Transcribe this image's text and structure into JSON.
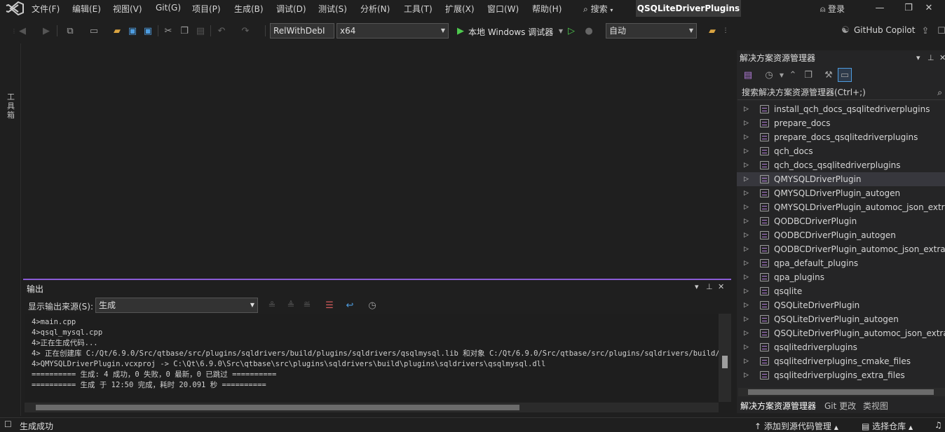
{
  "menu": [
    "文件(F)",
    "编辑(E)",
    "视图(V)",
    "Git(G)",
    "项目(P)",
    "生成(B)",
    "调试(D)",
    "测试(S)",
    "分析(N)",
    "工具(T)",
    "扩展(X)",
    "窗口(W)",
    "帮助(H)"
  ],
  "search_label": "搜索",
  "solution_name": "QSQLiteDriverPlugins",
  "login_label": "登录",
  "toolbar": {
    "config": "RelWithDebI",
    "platform": "x64",
    "run_label": "本地 Windows 调试器",
    "auto_label": "自动",
    "copilot_label": "GitHub Copilot"
  },
  "toolbox_label": "工具箱",
  "output": {
    "title": "输出",
    "source_label": "显示输出来源(S):",
    "source_value": "生成",
    "lines": [
      "4>main.cpp",
      "4>qsql_mysql.cpp",
      "4>正在生成代码...",
      "4>  正在创建库 C:/Qt/6.9.0/Src/qtbase/src/plugins/sqldrivers/build/plugins/sqldrivers/qsqlmysql.lib 和对象 C:/Qt/6.9.0/Src/qtbase/src/plugins/sqldrivers/build/plug",
      "4>QMYSQLDriverPlugin.vcxproj -> C:\\Qt\\6.9.0\\Src\\qtbase\\src\\plugins\\sqldrivers\\build\\plugins\\sqldrivers\\qsqlmysql.dll",
      "========== 生成: 4 成功，0 失败，0 最新，0 已跳过 ==========",
      "========== 生成 于 12:50 完成，耗时 20.091 秒 =========="
    ]
  },
  "solution_explorer": {
    "title": "解决方案资源管理器",
    "search_placeholder": "搜索解决方案资源管理器(Ctrl+;)",
    "items": [
      "install_qch_docs_qsqlitedriverplugins",
      "prepare_docs",
      "prepare_docs_qsqlitedriverplugins",
      "qch_docs",
      "qch_docs_qsqlitedriverplugins",
      "QMYSQLDriverPlugin",
      "QMYSQLDriverPlugin_autogen",
      "QMYSQLDriverPlugin_automoc_json_extra",
      "QODBCDriverPlugin",
      "QODBCDriverPlugin_autogen",
      "QODBCDriverPlugin_automoc_json_extrac",
      "qpa_default_plugins",
      "qpa_plugins",
      "qsqlite",
      "QSQLiteDriverPlugin",
      "QSQLiteDriverPlugin_autogen",
      "QSQLiteDriverPlugin_automoc_json_extra",
      "qsqlitedriverplugins",
      "qsqlitedriverplugins_cmake_files",
      "qsqlitedriverplugins_extra_files"
    ],
    "selected_index": 5,
    "tabs": [
      "解决方案资源管理器",
      "Git 更改",
      "类视图"
    ]
  },
  "status": {
    "message": "生成成功",
    "add_source": "添加到源代码管理",
    "select_repo": "选择仓库"
  },
  "colors": {
    "accent": "#8a5cd6",
    "background": "#1f1f1f"
  }
}
